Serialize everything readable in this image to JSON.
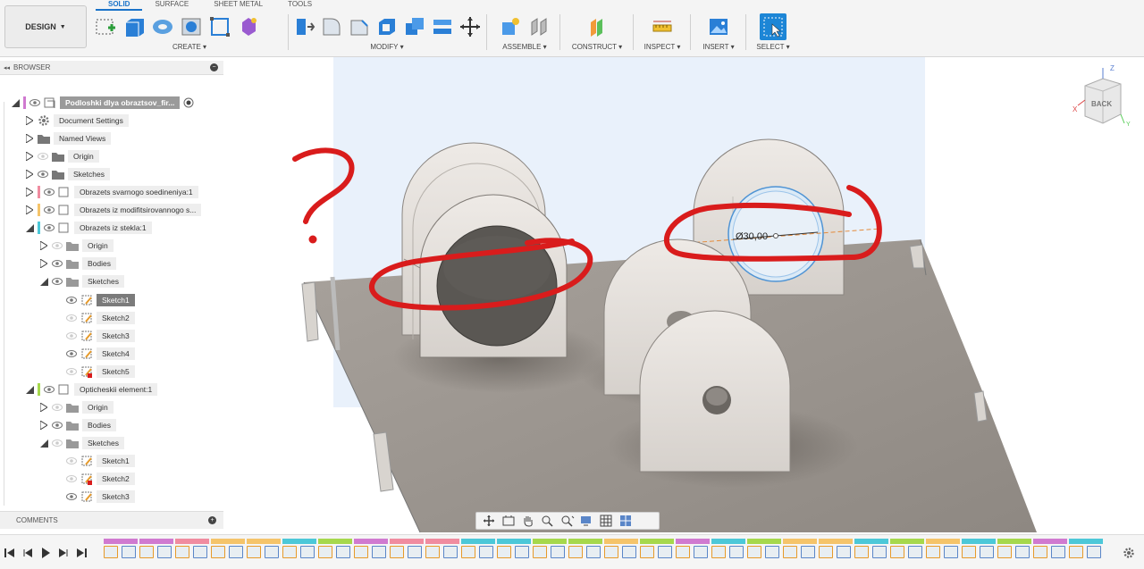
{
  "toolbar": {
    "workspace": "DESIGN",
    "tabs": [
      "SOLID",
      "SURFACE",
      "SHEET METAL",
      "TOOLS"
    ],
    "active_tab": "SOLID",
    "groups": {
      "create": "CREATE",
      "modify": "MODIFY",
      "assemble": "ASSEMBLE",
      "construct": "CONSTRUCT",
      "inspect": "INSPECT",
      "insert": "INSERT",
      "select": "SELECT"
    }
  },
  "browser": {
    "title": "BROWSER",
    "root": "Podloshki dlya obraztsov_fir...",
    "items": {
      "document_settings": "Document Settings",
      "named_views": "Named Views",
      "origin": "Origin",
      "sketches": "Sketches",
      "comp1": "Obrazets svarnogo soedineniya:1",
      "comp2": "Obrazets iz modifitsirovannogo s...",
      "comp3": "Obrazets iz stekla:1",
      "comp3_origin": "Origin",
      "comp3_bodies": "Bodies",
      "comp3_sketches": "Sketches",
      "comp3_sketch1": "Sketch1",
      "comp3_sketch2": "Sketch2",
      "comp3_sketch3": "Sketch3",
      "comp3_sketch4": "Sketch4",
      "comp3_sketch5": "Sketch5",
      "comp4": "Opticheskii element:1",
      "comp4_origin": "Origin",
      "comp4_bodies": "Bodies",
      "comp4_sketches": "Sketches",
      "comp4_sketch1": "Sketch1",
      "comp4_sketch2": "Sketch2",
      "comp4_sketch3": "Sketch3"
    }
  },
  "comments": {
    "title": "COMMENTS"
  },
  "viewcube": {
    "face": "BACK",
    "axis_z": "Z",
    "axis_x": "X",
    "axis_y": "Y"
  },
  "dimension": {
    "label": "Ø30,00"
  },
  "annotation": {
    "question_mark": "?"
  },
  "colors": {
    "accent": "#1a73c9",
    "annotation_red": "#d91c1c",
    "component_pink": "#f08ca0",
    "component_yellow": "#f5c46a",
    "component_cyan": "#4cc8d8",
    "component_green": "#a6d84c",
    "root_magenta": "#d07ad0"
  }
}
